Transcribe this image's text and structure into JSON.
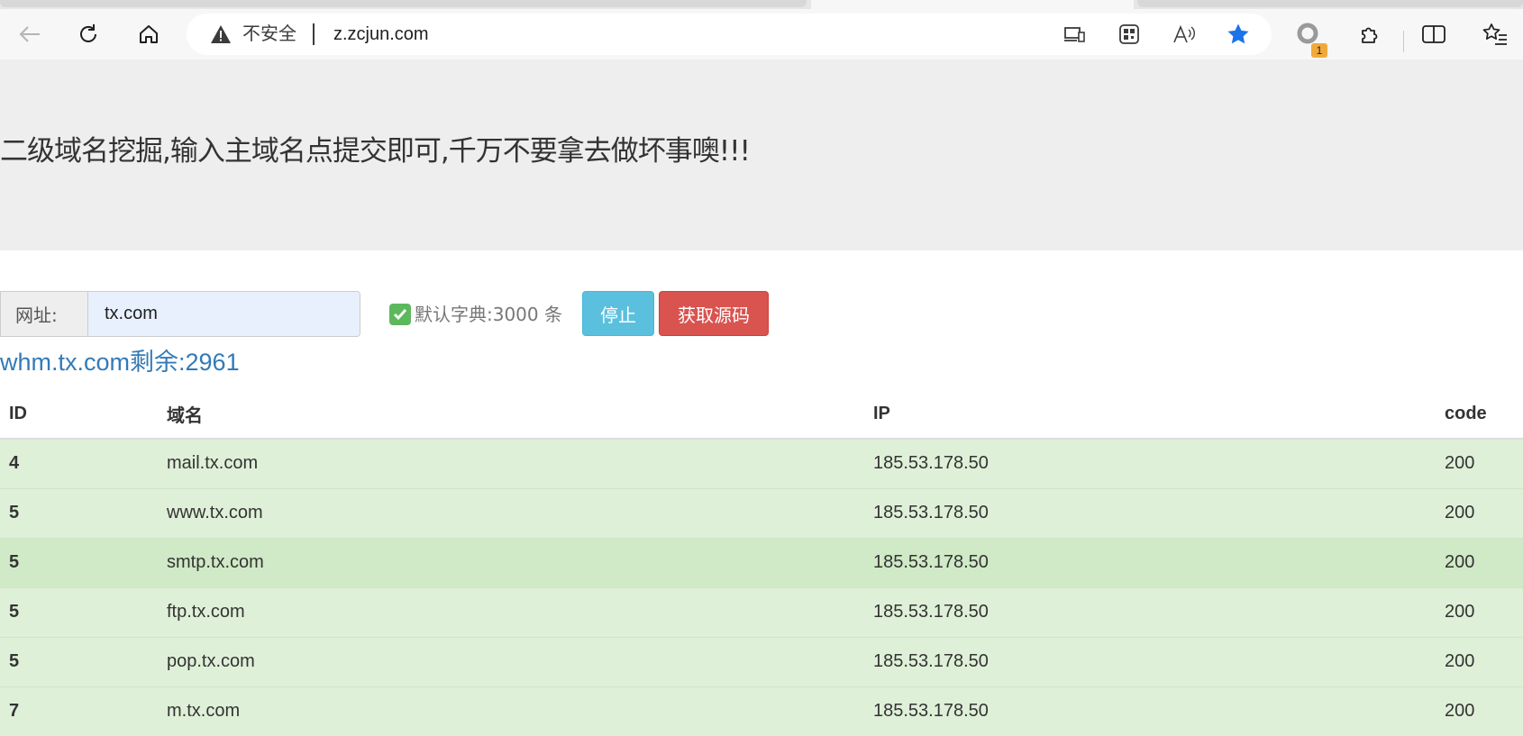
{
  "browser": {
    "security_label": "不安全",
    "url": "z.zcjun.com",
    "extension_badge": "1"
  },
  "page": {
    "headline": "二级域名挖掘,输入主域名点提交即可,千万不要拿去做坏事噢!!!",
    "form": {
      "url_label": "网址:",
      "url_value": "tx.com",
      "dict_label": "默认字典:3000 条",
      "dict_checked": true,
      "stop_button": "停止",
      "source_button": "获取源码"
    },
    "progress": "whm.tx.com剩余:2961",
    "table": {
      "headers": [
        "ID",
        "域名",
        "IP",
        "code"
      ],
      "rows": [
        {
          "id": "4",
          "domain": "mail.tx.com",
          "ip": "185.53.178.50",
          "code": "200"
        },
        {
          "id": "5",
          "domain": "www.tx.com",
          "ip": "185.53.178.50",
          "code": "200"
        },
        {
          "id": "5",
          "domain": "smtp.tx.com",
          "ip": "185.53.178.50",
          "code": "200"
        },
        {
          "id": "5",
          "domain": "ftp.tx.com",
          "ip": "185.53.178.50",
          "code": "200"
        },
        {
          "id": "5",
          "domain": "pop.tx.com",
          "ip": "185.53.178.50",
          "code": "200"
        },
        {
          "id": "7",
          "domain": "m.tx.com",
          "ip": "185.53.178.50",
          "code": "200"
        }
      ]
    }
  },
  "colors": {
    "success_row": "#dff0d8",
    "link": "#337ab7",
    "btn_info": "#5bc0de",
    "btn_danger": "#d9534f",
    "favorite_star": "#1a73e8"
  }
}
